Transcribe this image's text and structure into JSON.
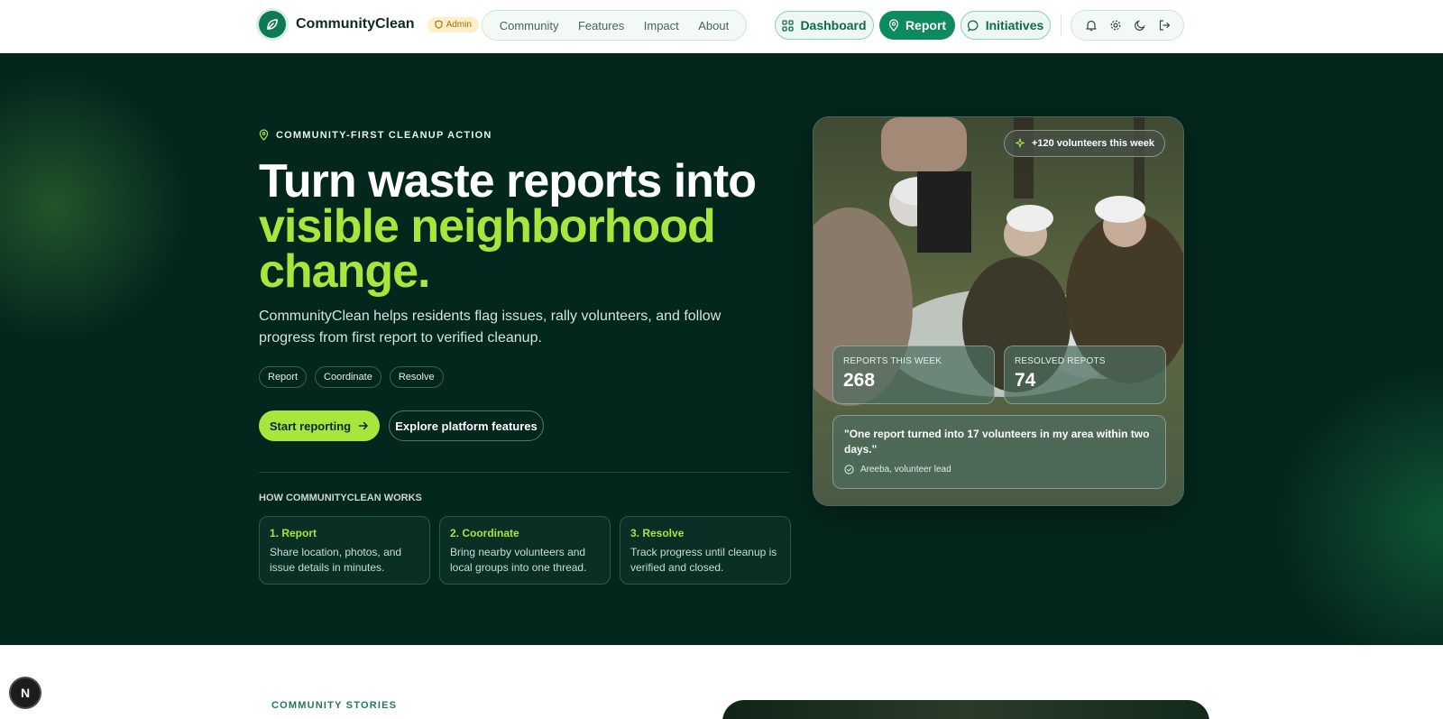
{
  "header": {
    "brand": "CommunityClean",
    "role_badge": "Admin",
    "nav": [
      "Community",
      "Features",
      "Impact",
      "About"
    ],
    "buttons": {
      "dashboard": "Dashboard",
      "report": "Report",
      "initiatives": "Initiatives"
    },
    "icons": [
      "bell-icon",
      "gear-icon",
      "moon-icon",
      "logout-icon"
    ]
  },
  "hero": {
    "eyebrow": "COMMUNITY-FIRST CLEANUP ACTION",
    "headline_line1": "Turn waste reports into",
    "headline_accent": "visible neighborhood change.",
    "subtext": "CommunityClean helps residents flag issues, rally volunteers, and follow progress from first report to verified cleanup.",
    "chips": [
      "Report",
      "Coordinate",
      "Resolve"
    ],
    "cta_primary": "Start reporting",
    "cta_secondary": "Explore platform features",
    "how_title": "HOW COMMUNITYCLEAN WORKS",
    "steps": [
      {
        "title": "1. Report",
        "text": "Share location, photos, and issue details in minutes."
      },
      {
        "title": "2. Coordinate",
        "text": "Bring nearby volunteers and local groups into one thread."
      },
      {
        "title": "3. Resolve",
        "text": "Track progress until cleanup is verified and closed."
      }
    ]
  },
  "photo_card": {
    "volunteers_badge": "+120 volunteers this week",
    "stats": [
      {
        "label": "REPORTS THIS WEEK",
        "value": "268"
      },
      {
        "label": "RESOLVED REPOTS",
        "value": "74"
      }
    ],
    "quote": "\"One report turned into 17 volunteers in my area within two days.\"",
    "quote_author": "Areeba, volunteer lead"
  },
  "stories": {
    "label": "COMMUNITY STORIES"
  },
  "dev_indicator": "N",
  "colors": {
    "accent_lime": "#a9e63d",
    "brand_green": "#0e8a5f",
    "hero_bg": "#04271d"
  }
}
